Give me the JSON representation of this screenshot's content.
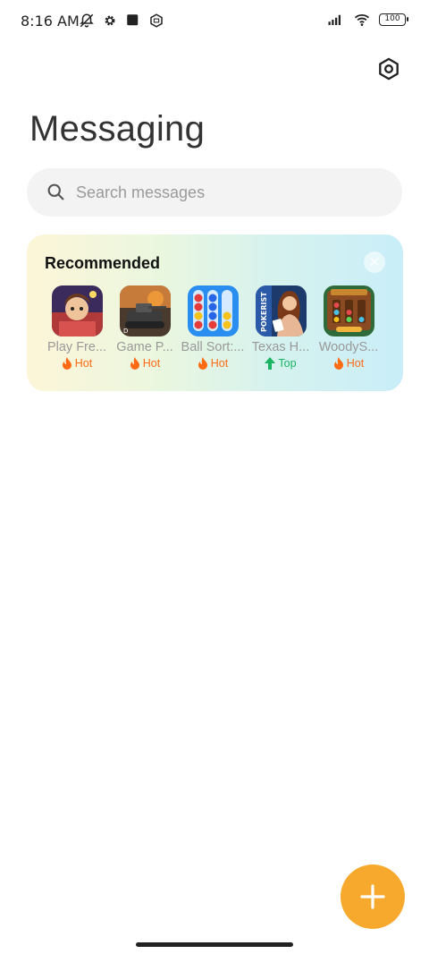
{
  "status_bar": {
    "time": "8:16 AM",
    "battery": "100",
    "icons_left": [
      "notifications-off-icon",
      "settings-cog-icon",
      "square-icon",
      "nfc-icon"
    ],
    "icons_right": [
      "signal-icon",
      "wifi-icon",
      "battery-icon"
    ]
  },
  "header": {
    "title": "Messaging",
    "settings_icon": "hexagon-settings-icon"
  },
  "search": {
    "placeholder": "Search messages"
  },
  "recommended": {
    "title": "Recommended",
    "close_icon": "close-icon",
    "apps": [
      {
        "name": "Play Fre...",
        "tag": "Hot",
        "tag_type": "hot"
      },
      {
        "name": "Game P...",
        "tag": "Hot",
        "tag_type": "hot"
      },
      {
        "name": "Ball Sort:...",
        "tag": "Hot",
        "tag_type": "hot"
      },
      {
        "name": "Texas H...",
        "tag": "Top",
        "tag_type": "top"
      },
      {
        "name": "WoodyS...",
        "tag": "Hot",
        "tag_type": "hot"
      }
    ]
  },
  "fab": {
    "icon": "plus-icon"
  },
  "colors": {
    "accent": "#f7a92e",
    "hot": "#ff6a13",
    "top": "#18b462"
  }
}
